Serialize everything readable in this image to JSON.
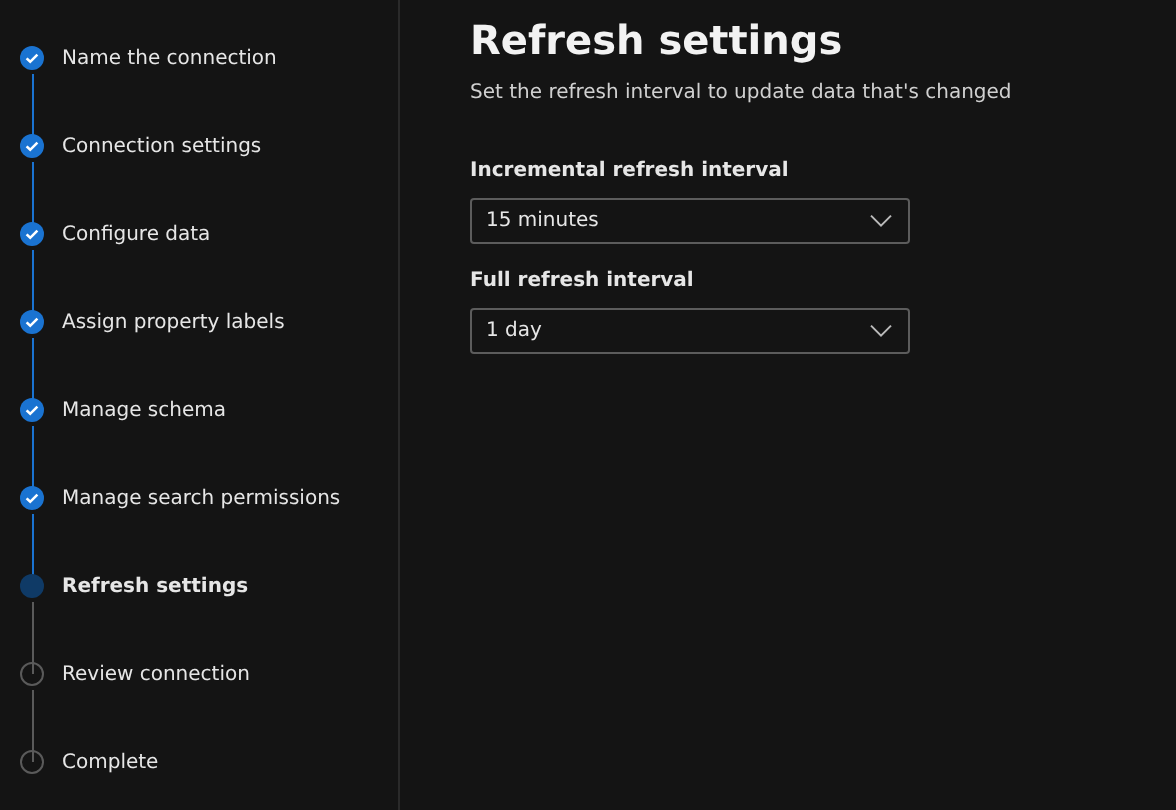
{
  "steps": [
    {
      "label": "Name the connection",
      "completed": true,
      "selected": false
    },
    {
      "label": "Connection settings",
      "completed": true,
      "selected": false
    },
    {
      "label": "Configure data",
      "completed": true,
      "selected": false
    },
    {
      "label": "Assign property labels",
      "completed": true,
      "selected": false
    },
    {
      "label": "Manage schema",
      "completed": true,
      "selected": false
    },
    {
      "label": "Manage search permissions",
      "completed": true,
      "selected": false
    },
    {
      "label": "Refresh settings",
      "completed": false,
      "selected": true
    },
    {
      "label": "Review connection",
      "completed": false,
      "selected": false
    },
    {
      "label": "Complete",
      "completed": false,
      "selected": false
    }
  ],
  "page": {
    "title": "Refresh settings",
    "subtitle": "Set the refresh interval to update data that's changed"
  },
  "fields": [
    {
      "label": "Incremental refresh interval",
      "value": "15 minutes"
    },
    {
      "label": "Full refresh interval",
      "value": "1 day"
    }
  ]
}
